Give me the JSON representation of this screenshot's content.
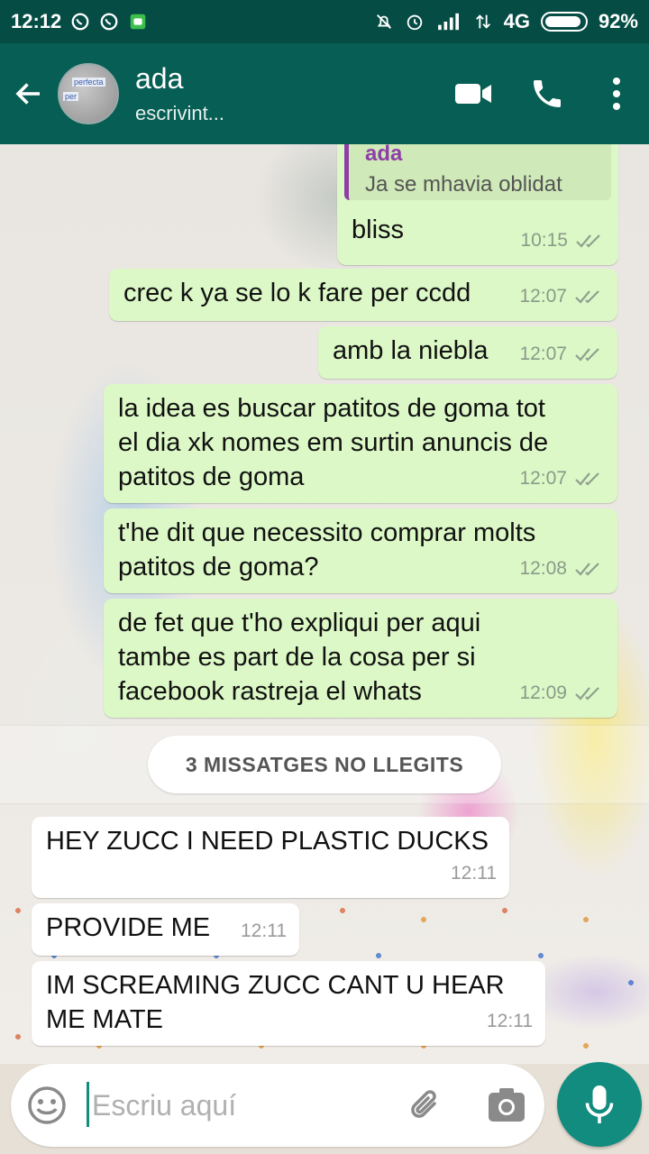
{
  "status_bar": {
    "time": "12:12",
    "network": "4G",
    "battery_percent": "92%",
    "battery_level": 0.92
  },
  "header": {
    "contact_name": "ada",
    "contact_status": "escrivint...",
    "avatar_text_1": "perfecta",
    "avatar_text_2": "per"
  },
  "messages": [
    {
      "direction": "out",
      "quote_author": "ada",
      "quote_text": "Ja se mhavia oblidat",
      "text": "bliss",
      "time": "10:15"
    },
    {
      "direction": "out",
      "text": "crec k ya se lo k fare per ccdd",
      "time": "12:07"
    },
    {
      "direction": "out",
      "text": "amb la niebla",
      "time": "12:07"
    },
    {
      "direction": "out",
      "text": "la idea es buscar patitos de goma tot\nel dia xk nomes em surtin anuncis de\npatitos de goma",
      "time": "12:07"
    },
    {
      "direction": "out",
      "text": "t'he dit que necessito comprar molts\npatitos de goma?",
      "time": "12:08"
    },
    {
      "direction": "out",
      "text": "de fet que t'ho expliqui per aqui\ntambe es part de la cosa per si\nfacebook rastreja el whats",
      "time": "12:09"
    },
    {
      "direction": "in",
      "text": "HEY ZUCC I NEED PLASTIC DUCKS",
      "time": "12:11"
    },
    {
      "direction": "in",
      "text": "PROVIDE ME",
      "time": "12:11"
    },
    {
      "direction": "in",
      "text": "IM SCREAMING ZUCC CANT U HEAR\nME MATE",
      "time": "12:11"
    }
  ],
  "unread_divider": "3 MISSATGES NO LLEGITS",
  "composer": {
    "placeholder": "Escriu aquí"
  },
  "colors": {
    "header": "#075e54",
    "status_bar": "#054d44",
    "outgoing_bubble": "#dcf8c6",
    "incoming_bubble": "#ffffff",
    "accent": "#128c7e",
    "quote_author": "#8e3fa6"
  },
  "icons": [
    "back-arrow-icon",
    "video-call-icon",
    "phone-icon",
    "more-options-icon",
    "emoji-icon",
    "attach-icon",
    "camera-icon",
    "mic-icon",
    "double-tick-icon",
    "whatsapp-icon",
    "mute-icon",
    "alarm-icon",
    "signal-icon",
    "battery-icon"
  ]
}
